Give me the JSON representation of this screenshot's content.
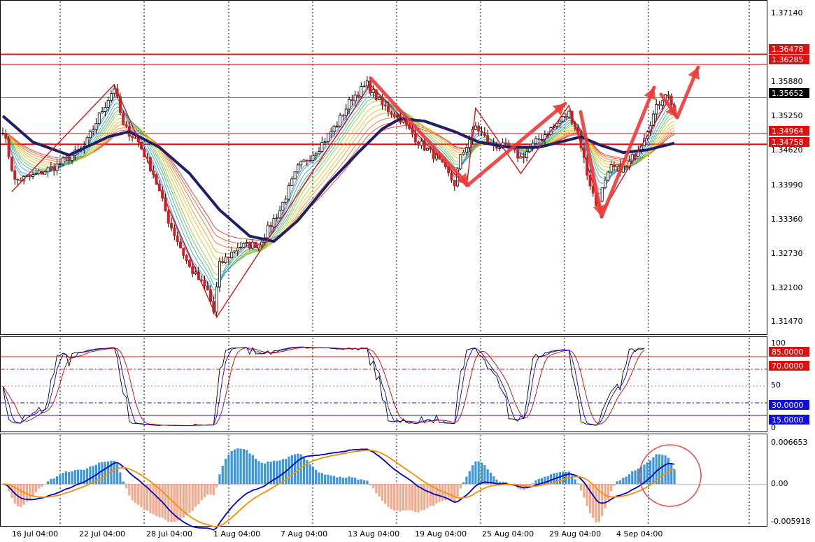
{
  "colors": {
    "background": "#ffffff",
    "plot_background": "#f0f0f0",
    "bull_candle": "#ffffff",
    "bear_candle": "#cc2222",
    "ma_thick": "#1f1f66",
    "annotation_red": "#ee3a3a",
    "level_line": "#e01010",
    "current_price_line": "#5577cc",
    "stoch_black": "#000000",
    "stoch_blue": "#0000cc",
    "stoch_red": "#cc0000",
    "macd_pos": "#3c96dc",
    "macd_neg": "#f5a98c",
    "macd_line": "#0000bb",
    "signal_line": "#ff8c00"
  },
  "chart_data": [
    {
      "type": "candlestick",
      "name": "price",
      "ylim": [
        1.3115,
        1.3745
      ],
      "price_ticks": [
        "1.37140",
        "1.35880",
        "1.35250",
        "1.34620",
        "1.33990",
        "1.33360",
        "1.32730",
        "1.32100",
        "1.31470"
      ],
      "levels": [
        {
          "label": "1.36478",
          "value": 1.36478
        },
        {
          "label": "1.36285",
          "value": 1.36285
        },
        {
          "label": "1.34964",
          "value": 1.34964
        },
        {
          "label": "1.34758",
          "value": 1.34758
        }
      ],
      "current_price": {
        "label": "1.35652",
        "value": 1.35652
      },
      "anchors": [
        [
          0,
          1.3505
        ],
        [
          4,
          1.3405
        ],
        [
          10,
          1.3415
        ],
        [
          18,
          1.3435
        ],
        [
          27,
          1.347
        ],
        [
          32,
          1.353
        ],
        [
          37,
          1.3585
        ],
        [
          40,
          1.351
        ],
        [
          45,
          1.348
        ],
        [
          50,
          1.342
        ],
        [
          55,
          1.333
        ],
        [
          62,
          1.324
        ],
        [
          68,
          1.3195
        ],
        [
          70,
          1.3155
        ],
        [
          72,
          1.3245
        ],
        [
          78,
          1.328
        ],
        [
          85,
          1.3285
        ],
        [
          92,
          1.335
        ],
        [
          98,
          1.343
        ],
        [
          105,
          1.347
        ],
        [
          111,
          1.3515
        ],
        [
          116,
          1.3565
        ],
        [
          121,
          1.359
        ],
        [
          126,
          1.355
        ],
        [
          132,
          1.3525
        ],
        [
          138,
          1.348
        ],
        [
          144,
          1.345
        ],
        [
          150,
          1.34
        ],
        [
          152,
          1.345
        ],
        [
          157,
          1.351
        ],
        [
          162,
          1.3475
        ],
        [
          167,
          1.347
        ],
        [
          172,
          1.345
        ],
        [
          178,
          1.3485
        ],
        [
          183,
          1.351
        ],
        [
          188,
          1.3535
        ],
        [
          191,
          1.35
        ],
        [
          194,
          1.342
        ],
        [
          197,
          1.336
        ],
        [
          202,
          1.343
        ],
        [
          207,
          1.343
        ],
        [
          212,
          1.348
        ],
        [
          217,
          1.3545
        ],
        [
          220,
          1.3575
        ],
        [
          223,
          1.3545
        ]
      ],
      "ma_thick_anchors": [
        [
          0,
          1.353
        ],
        [
          10,
          1.348
        ],
        [
          22,
          1.3455
        ],
        [
          35,
          1.349
        ],
        [
          42,
          1.35
        ],
        [
          52,
          1.347
        ],
        [
          62,
          1.342
        ],
        [
          72,
          1.335
        ],
        [
          82,
          1.33
        ],
        [
          90,
          1.329
        ],
        [
          98,
          1.333
        ],
        [
          108,
          1.34
        ],
        [
          118,
          1.346
        ],
        [
          126,
          1.3505
        ],
        [
          132,
          1.3525
        ],
        [
          140,
          1.352
        ],
        [
          150,
          1.35
        ],
        [
          158,
          1.348
        ],
        [
          168,
          1.347
        ],
        [
          178,
          1.347
        ],
        [
          185,
          1.348
        ],
        [
          192,
          1.349
        ],
        [
          198,
          1.3475
        ],
        [
          206,
          1.346
        ],
        [
          214,
          1.3465
        ],
        [
          223,
          1.3478
        ]
      ],
      "zigzag": [
        [
          3,
          1.3385
        ],
        [
          37,
          1.359
        ],
        [
          71,
          1.3145
        ],
        [
          87,
          1.3285
        ],
        [
          122,
          1.359
        ],
        [
          154,
          1.3395
        ],
        [
          157,
          1.3545
        ],
        [
          172,
          1.342
        ],
        [
          188,
          1.355
        ],
        [
          199,
          1.3345
        ],
        [
          222,
          1.357
        ]
      ]
    },
    {
      "type": "line",
      "name": "stochastic",
      "ylim": [
        0,
        100
      ],
      "axis_labels": [
        "100",
        "50",
        "0"
      ],
      "levels": [
        {
          "label": "85.0000",
          "value": 85
        },
        {
          "label": "70.0000",
          "value": 70
        },
        {
          "label": "30.0000",
          "value": 30
        },
        {
          "label": "15.0000",
          "value": 15
        }
      ]
    },
    {
      "type": "bar",
      "name": "macd",
      "ylim": [
        -0.0063,
        0.007
      ],
      "axis_labels": [
        "0.006653",
        "0.00",
        "-0.005918"
      ]
    }
  ],
  "x_axis_labels": [
    "16 Jul 04:00",
    "22 Jul 04:00",
    "28 Jul 04:00",
    "1 Aug 04:00",
    "7 Aug 04:00",
    "13 Aug 04:00",
    "19 Aug 04:00",
    "25 Aug 04:00",
    "29 Aug 04:00",
    "4 Sep 04:00"
  ]
}
